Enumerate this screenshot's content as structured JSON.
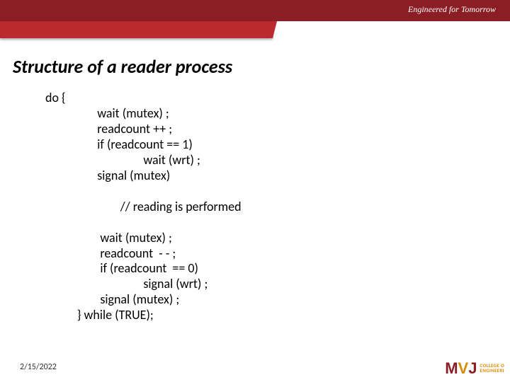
{
  "header": {
    "tagline": "Engineered for Tomorrow"
  },
  "slide": {
    "title": "Structure of a reader process"
  },
  "code": {
    "l01": "do {",
    "l02": "                  wait (mutex) ;",
    "l03": "                  readcount ++ ;",
    "l04": "                  if (readcount == 1)",
    "l05": "                                  wait (wrt) ;",
    "l06": "                  signal (mutex)",
    "l07": " ",
    "l08": "                          // reading is performed",
    "l09": " ",
    "l10": "                   wait (mutex) ;",
    "l11": "                   readcount  - - ;",
    "l12": "                   if (readcount  == 0)",
    "l13": "                                  signal (wrt) ;",
    "l14": "                   signal (mutex) ;",
    "l15": "           } while (TRUE);"
  },
  "footer": {
    "date": "2/15/2022"
  },
  "logo": {
    "mark": "MVJ",
    "text1": "COLLEGE O",
    "text2": "ENGINEERI"
  }
}
